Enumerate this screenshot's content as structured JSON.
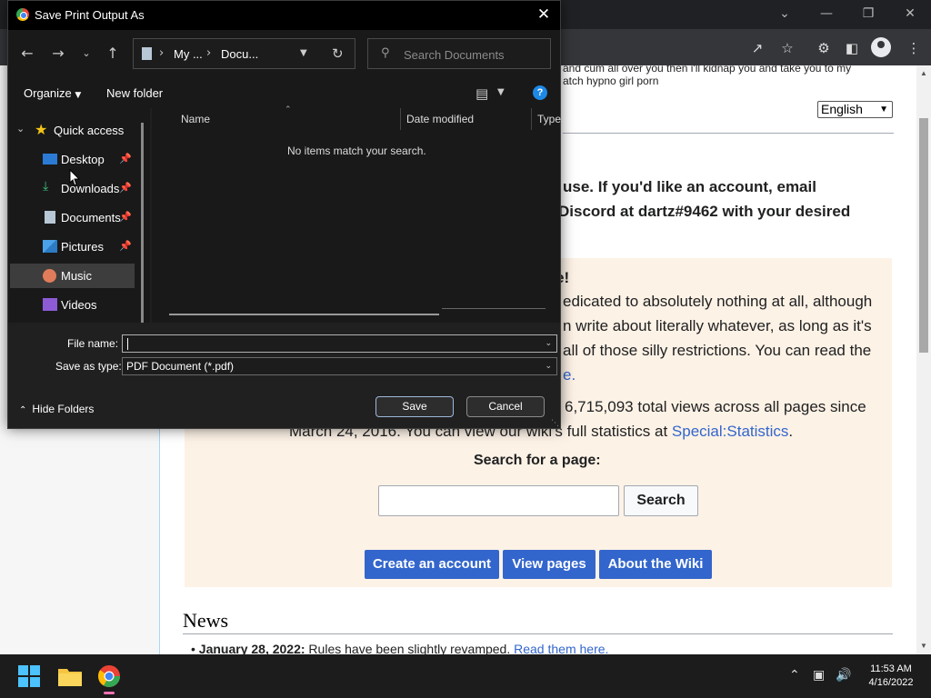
{
  "browser": {
    "top_text_line1": "and cum all over you then i'll kidnap you and take you to my",
    "top_text_line2": "atch hypno girl porn",
    "language": "English",
    "intro_line1": "use. If you'd like an account, email",
    "intro_line2": "Discord at dartz#9462 with your desired",
    "welcome_heading": "e!",
    "welcome_line1": "edicated to absolutely nothing at all, although",
    "welcome_line2": "n write about literally whatever, as long as it's",
    "welcome_line3": "all of those silly restrictions. You can read the",
    "welcome_line4_link": "e.",
    "stats_line1": "6,715,093 total views across all pages since",
    "stats_line2_prefix": "March 24, 2016. You can view our wiki's full statistics at ",
    "stats_link": "Special:Statistics",
    "stats_line2_suffix": ".",
    "search_label": "Search for a page:",
    "search_button": "Search",
    "buttons": [
      "Create an account",
      "View pages",
      "About the Wiki"
    ],
    "news_title": "News",
    "news_date": "January 28, 2022:",
    "news_text": " Rules have been slightly revamped. ",
    "news_link": "Read them here."
  },
  "dialog": {
    "title": "Save Print Output As",
    "breadcrumb": [
      "My ...",
      "Docu..."
    ],
    "search_placeholder": "Search Documents",
    "organize_label": "Organize",
    "new_folder_label": "New folder",
    "help_label": "?",
    "quick_access_label": "Quick access",
    "nav_items": [
      {
        "label": "Desktop",
        "pinned": true
      },
      {
        "label": "Downloads",
        "pinned": true
      },
      {
        "label": "Documents",
        "pinned": true
      },
      {
        "label": "Pictures",
        "pinned": true
      },
      {
        "label": "Music",
        "pinned": false,
        "selected": true
      },
      {
        "label": "Videos",
        "pinned": false
      }
    ],
    "columns": [
      "Name",
      "Date modified",
      "Type"
    ],
    "empty_message": "No items match your search.",
    "file_name_label": "File name:",
    "file_name_value": "",
    "save_type_label": "Save as type:",
    "save_type_value": "PDF Document (*.pdf)",
    "hide_folders_label": "Hide Folders",
    "save_button": "Save",
    "cancel_button": "Cancel"
  },
  "taskbar": {
    "time": "11:53 AM",
    "date": "4/16/2022"
  },
  "colors": {
    "link": "#3366cc",
    "wiki_button": "#3366cc",
    "welcome_bg": "#fdf2e6",
    "dialog_bg": "#202020",
    "selected_nav": "#3d3d3d"
  },
  "icons": [
    "chrome-icon",
    "close-icon",
    "back-arrow-icon",
    "forward-arrow-icon",
    "chevron-down-icon",
    "up-arrow-icon",
    "refresh-icon",
    "search-icon",
    "view-icon",
    "help-icon",
    "star-icon",
    "pin-icon",
    "desktop-icon",
    "downloads-icon",
    "documents-icon",
    "pictures-icon",
    "music-icon",
    "videos-icon",
    "windows-start-icon",
    "file-explorer-icon",
    "chevron-up-icon",
    "network-icon",
    "volume-icon"
  ]
}
